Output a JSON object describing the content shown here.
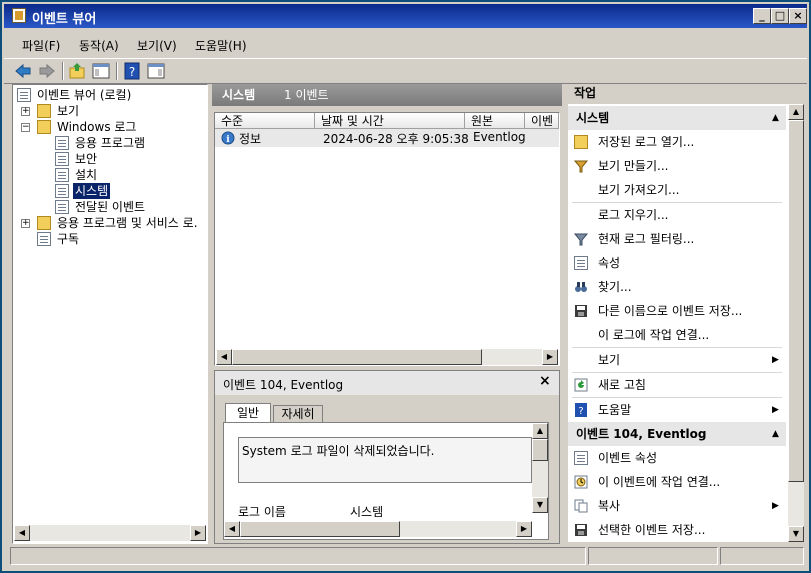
{
  "window": {
    "title": "이벤트 뷰어"
  },
  "menu": [
    "파일(F)",
    "동작(A)",
    "보기(V)",
    "도움말(H)"
  ],
  "tree": {
    "root": "이벤트 뷰어 (로컬)",
    "views": "보기",
    "windows_logs": "Windows 로그",
    "application": "응용 프로그램",
    "security": "보안",
    "setup": "설치",
    "system": "시스템",
    "forwarded": "전달된 이벤트",
    "apps_services": "응용 프로그램 및 서비스 로.",
    "subscriptions": "구독"
  },
  "log_header": {
    "name": "시스템",
    "count": "1 이벤트"
  },
  "columns": [
    "수준",
    "날짜 및 시간",
    "원본",
    "이벤"
  ],
  "events": [
    {
      "level": "정보",
      "datetime": "2024-06-28 오후 9:05:38",
      "source": "Eventlog"
    }
  ],
  "detail": {
    "title": "이벤트 104, Eventlog",
    "close": "×",
    "tabs": [
      "일반",
      "자세히"
    ],
    "message": "System 로그 파일이 삭제되었습니다.",
    "log_name_label": "로그 이름",
    "log_name_value": "시스템"
  },
  "actions": {
    "header": "작업",
    "section1": "시스템",
    "items1": [
      "저장된 로그 열기...",
      "보기 만들기...",
      "보기 가져오기...",
      "로그 지우기...",
      "현재 로그 필터링...",
      "속성",
      "찾기...",
      "다른 이름으로 이벤트 저장...",
      "이 로그에 작업 연결...",
      "보기",
      "새로 고침",
      "도움말"
    ],
    "section2": "이벤트 104, Eventlog",
    "items2": [
      "이벤트 속성",
      "이 이벤트에 작업 연결...",
      "복사",
      "선택한 이벤트 저장..."
    ]
  },
  "colors": {
    "accent": "#0b2a8a",
    "header_gray": "#8a8a8a",
    "selection": "#0a246a"
  }
}
